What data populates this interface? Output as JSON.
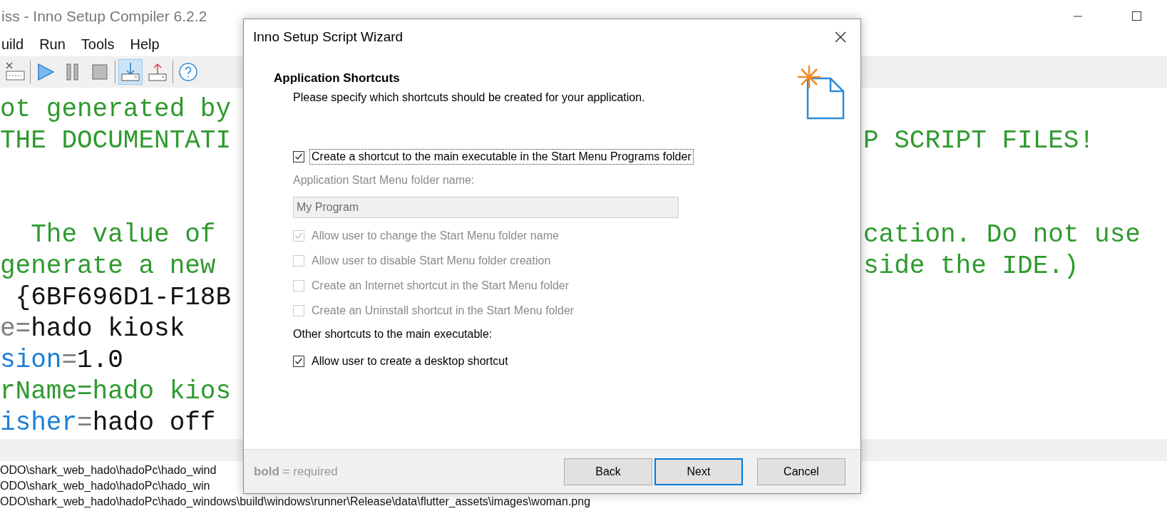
{
  "window": {
    "title": "iss - Inno Setup Compiler 6.2.2"
  },
  "menu": [
    "uild",
    "Run",
    "Tools",
    "Help"
  ],
  "toolbar": [
    {
      "kind": "compile",
      "selected": false
    },
    {
      "kind": "separator"
    },
    {
      "kind": "run",
      "selected": false
    },
    {
      "kind": "pause",
      "selected": false
    },
    {
      "kind": "stop",
      "selected": false
    },
    {
      "kind": "separator"
    },
    {
      "kind": "target-user",
      "selected": true
    },
    {
      "kind": "target-admin",
      "selected": false
    },
    {
      "kind": "separator"
    },
    {
      "kind": "help",
      "selected": false
    }
  ],
  "editor": {
    "lines": [
      {
        "kind": "code",
        "left": [
          {
            "kind": "comment",
            "text": "ot generated by"
          }
        ]
      },
      {
        "kind": "code",
        "left": [
          {
            "kind": "comment",
            "text": "THE DOCUMENTATI"
          }
        ],
        "right": [
          {
            "kind": "comment",
            "text": "P SCRIPT FILES!"
          }
        ]
      },
      {
        "kind": "blank"
      },
      {
        "kind": "blank"
      },
      {
        "kind": "code",
        "left": [
          {
            "kind": "comment",
            "text": "  The value of"
          }
        ],
        "right": [
          {
            "kind": "comment",
            "text": "cation. Do not use"
          }
        ]
      },
      {
        "kind": "code",
        "left": [
          {
            "kind": "comment",
            "text": "generate a new"
          }
        ],
        "right": [
          {
            "kind": "comment",
            "text": "side the IDE.)"
          }
        ]
      },
      {
        "kind": "code",
        "left": [
          {
            "kind": "value",
            "text": " {6BF696D1-F18B"
          }
        ]
      },
      {
        "kind": "code",
        "left": [
          {
            "kind": "symbol",
            "text": "e="
          },
          {
            "kind": "value",
            "text": "hado kiosk"
          }
        ]
      },
      {
        "kind": "code",
        "left": [
          {
            "kind": "key",
            "text": "sion"
          },
          {
            "kind": "symbol",
            "text": "="
          },
          {
            "kind": "value",
            "text": "1.0"
          }
        ]
      },
      {
        "kind": "code",
        "left": [
          {
            "kind": "comment",
            "text": "rName=hado kios"
          }
        ]
      },
      {
        "kind": "code",
        "left": [
          {
            "kind": "key",
            "text": "isher"
          },
          {
            "kind": "symbol",
            "text": "="
          },
          {
            "kind": "value",
            "text": "hado off"
          }
        ]
      }
    ]
  },
  "output": {
    "lines": [
      "ODO\\shark_web_hado\\hadoPc\\hado_wind",
      "ODO\\shark_web_hado\\hadoPc\\hado_win",
      "ODO\\shark_web_hado\\hadoPc\\hado_windows\\build\\windows\\runner\\Release\\data\\flutter_assets\\images\\woman.png"
    ]
  },
  "dialog": {
    "title": "Inno Setup Script Wizard",
    "heading": "Application Shortcuts",
    "subtitle": "Please specify which shortcuts should be created for your application.",
    "items": [
      {
        "kind": "checkbox",
        "label": "Create a shortcut to the main executable in the Start Menu Programs folder",
        "checked": true,
        "disabled": false,
        "focused": true
      },
      {
        "kind": "label",
        "text": "Application Start Menu folder name:",
        "disabled": true
      },
      {
        "kind": "field",
        "value": "My Program",
        "disabled": true
      },
      {
        "kind": "checkbox",
        "label": "Allow user to change the Start Menu folder name",
        "checked": true,
        "disabled": true,
        "focused": false
      },
      {
        "kind": "checkbox",
        "label": "Allow user to disable Start Menu folder creation",
        "checked": false,
        "disabled": true,
        "focused": false
      },
      {
        "kind": "checkbox",
        "label": "Create an Internet shortcut in the Start Menu folder",
        "checked": false,
        "disabled": true,
        "focused": false
      },
      {
        "kind": "checkbox",
        "label": "Create an Uninstall shortcut in the Start Menu folder",
        "checked": false,
        "disabled": true,
        "focused": false
      },
      {
        "kind": "label",
        "text": "Other shortcuts to the main executable:",
        "disabled": false
      },
      {
        "kind": "checkbox",
        "label": "Allow user to create a desktop shortcut",
        "checked": true,
        "disabled": false,
        "focused": false
      }
    ],
    "legend": "**bold** = required",
    "buttons": [
      {
        "label": "Back",
        "focused": false
      },
      {
        "label": "Next",
        "focused": true
      },
      {
        "label": "Cancel",
        "focused": false
      }
    ]
  }
}
